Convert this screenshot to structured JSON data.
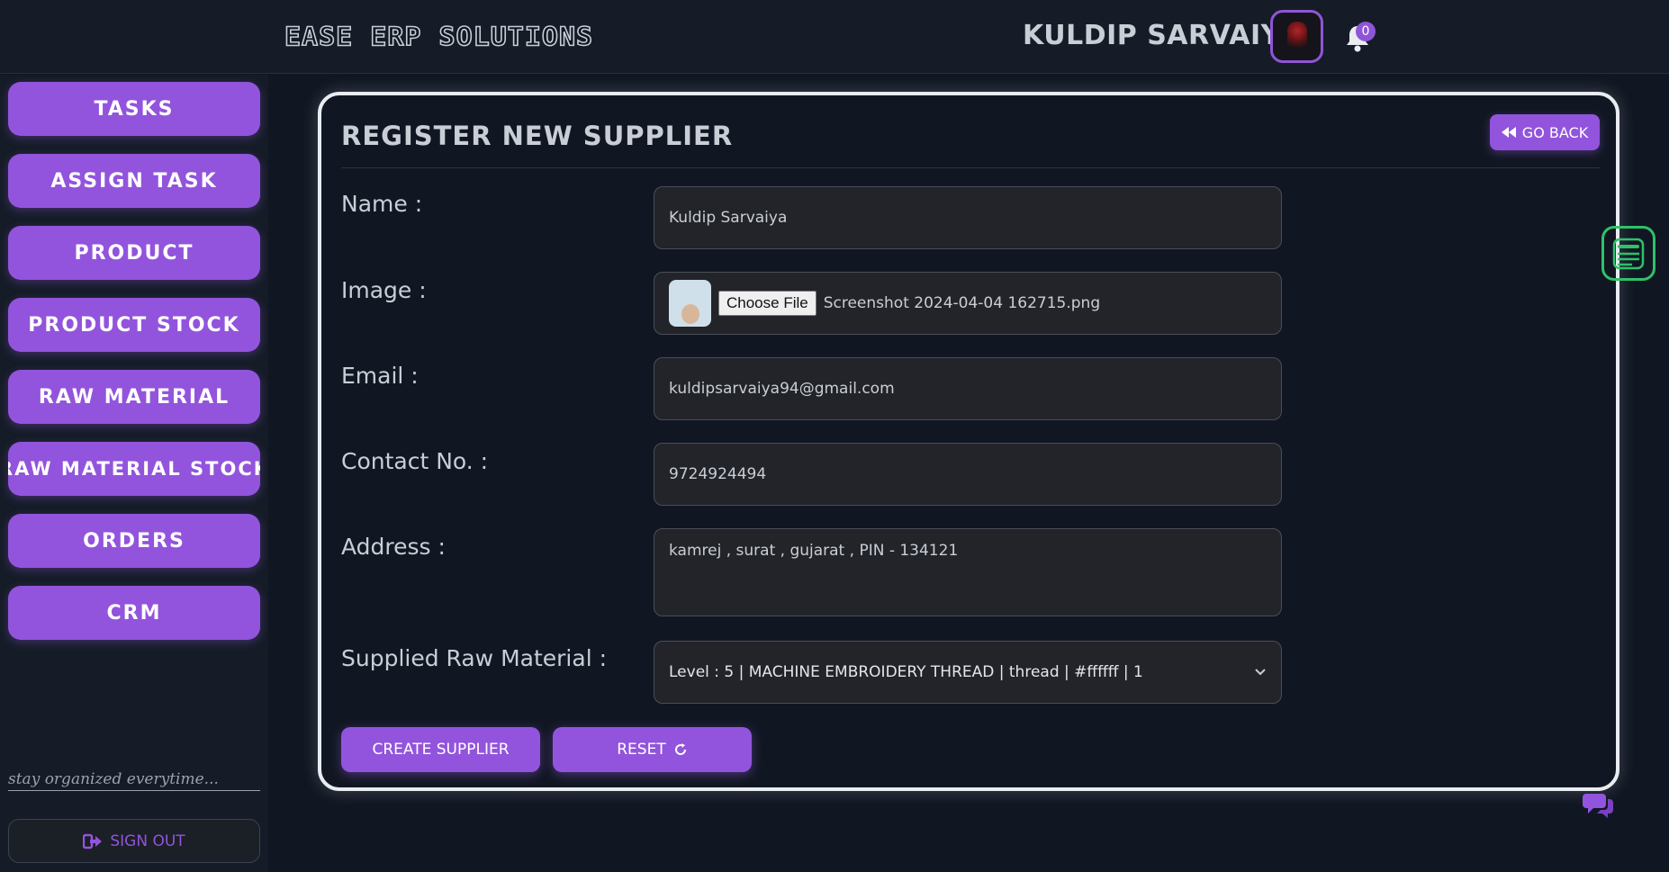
{
  "header": {
    "brand": "EASE ERP SOLUTIONS",
    "username": "KULDIP SARVAIYA",
    "notification_count": "0"
  },
  "sidebar": {
    "items": [
      {
        "label": "TASKS"
      },
      {
        "label": "ASSIGN TASK"
      },
      {
        "label": "PRODUCT"
      },
      {
        "label": "PRODUCT STOCK"
      },
      {
        "label": "RAW MATERIAL"
      },
      {
        "label": "RAW MATERIAL STOCK"
      },
      {
        "label": "ORDERS"
      },
      {
        "label": "CRM"
      }
    ],
    "tagline": "stay organized everytime...",
    "signout_label": "SIGN OUT"
  },
  "form": {
    "title": "REGISTER NEW SUPPLIER",
    "go_back_label": "GO BACK",
    "name_label": "Name :",
    "name_value": "Kuldip Sarvaiya",
    "image_label": "Image :",
    "choose_file_label": "Choose File",
    "file_name": "Screenshot 2024-04-04 162715.png",
    "email_label": "Email :",
    "email_value": "kuldipsarvaiya94@gmail.com",
    "contact_label": "Contact No. :",
    "contact_value": "9724924494",
    "address_label": "Address :",
    "address_value": "kamrej , surat , gujarat , PIN - 134121",
    "raw_material_label": "Supplied Raw Material :",
    "raw_material_selected": "Level : 5 | MACHINE EMBROIDERY THREAD | thread | #ffffff | 1",
    "create_label": "CREATE SUPPLIER",
    "reset_label": "RESET"
  },
  "colors": {
    "accent": "#9254dc",
    "background": "#111722",
    "widget_green": "#2ec26a"
  },
  "icons": [
    "bell-icon",
    "go-back-icon",
    "refresh-icon",
    "sign-out-icon",
    "list-widget-icon",
    "chat-icon",
    "chevron-down-icon"
  ]
}
